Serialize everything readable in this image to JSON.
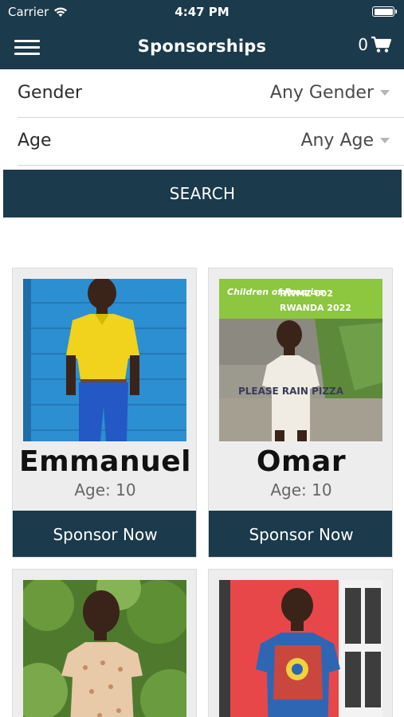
{
  "status_bar": {
    "carrier": "Carrier",
    "time": "4:47 PM"
  },
  "nav": {
    "title": "Sponsorships",
    "cart_count": "0"
  },
  "filters": {
    "gender": {
      "label": "Gender",
      "value": "Any Gender"
    },
    "age": {
      "label": "Age",
      "value": "Any Age"
    }
  },
  "search_label": "SEARCH",
  "children": [
    {
      "name": "Emmanuel",
      "age": "Age: 10",
      "button": "Sponsor Now"
    },
    {
      "name": "Omar",
      "age": "Age: 10",
      "button": "Sponsor Now",
      "photo_banner": {
        "logo": "Children of Promise",
        "code": "RWMZ-002",
        "region": "RWANDA 2022"
      },
      "shirt_text": "PLEASE RAIN PIZZA"
    },
    {
      "name": "",
      "age": "",
      "button": ""
    },
    {
      "name": "",
      "age": "",
      "button": ""
    }
  ],
  "colors": {
    "primary": "#1b3a4b",
    "card_bg": "#ededee",
    "banner_green": "#8dc63f"
  }
}
